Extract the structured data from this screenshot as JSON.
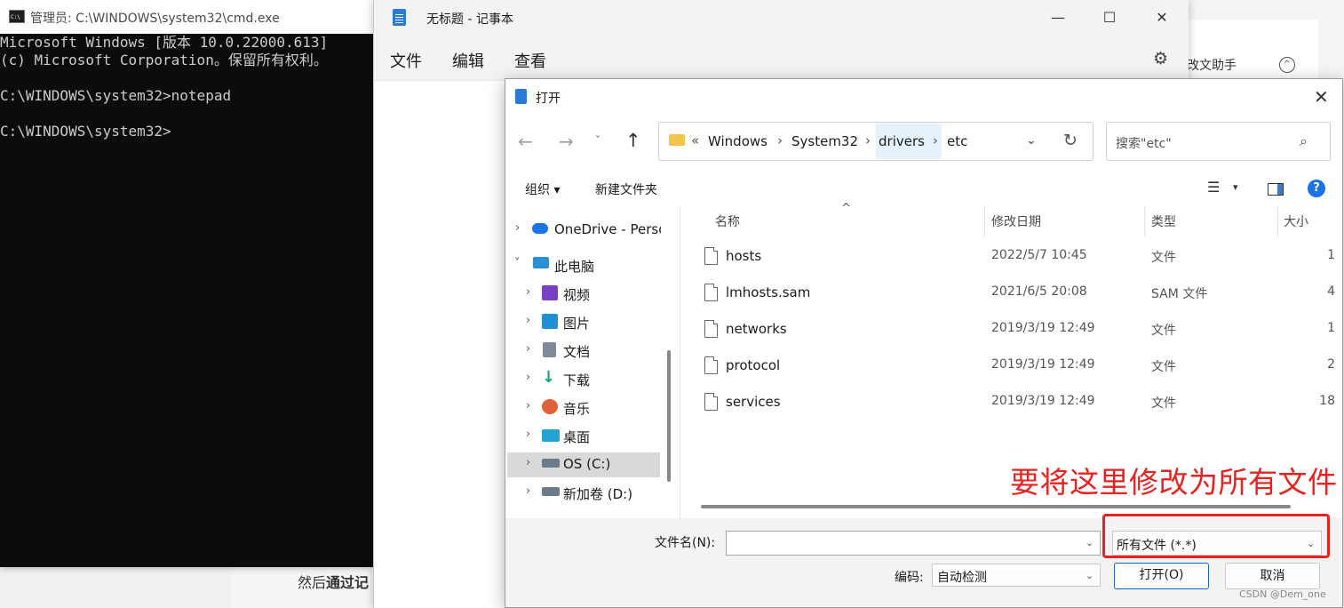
{
  "background": {
    "assistant_text": "改文助手",
    "bottom_text_prefix": "然后",
    "bottom_text_bold": "通过记"
  },
  "cmd": {
    "title": "管理员: C:\\WINDOWS\\system32\\cmd.exe",
    "lines": [
      "Microsoft Windows [版本 10.0.22000.613]",
      "(c) Microsoft Corporation。保留所有权利。",
      "",
      "C:\\WINDOWS\\system32>notepad",
      "",
      "C:\\WINDOWS\\system32>"
    ]
  },
  "notepad": {
    "title": "无标题 - 记事本",
    "menu": [
      "文件",
      "编辑",
      "查看"
    ]
  },
  "dialog": {
    "title": "打开",
    "breadcrumbs": [
      "Windows",
      "System32",
      "drivers",
      "etc"
    ],
    "search_placeholder": "搜索\"etc\"",
    "toolbar": {
      "organize": "组织 ▾",
      "new_folder": "新建文件夹"
    },
    "nav_tree": [
      {
        "label": "OneDrive - Perso",
        "icon": "onedrive-icon",
        "color": "#1a73e8"
      },
      {
        "label": "此电脑",
        "icon": "pc-icon",
        "color": "#2b8fd6"
      },
      {
        "label": "视频",
        "icon": "video-icon",
        "color": "#7b3fc4"
      },
      {
        "label": "图片",
        "icon": "picture-icon",
        "color": "#1f8fd6"
      },
      {
        "label": "文档",
        "icon": "document-icon",
        "color": "#7d8a99"
      },
      {
        "label": "下载",
        "icon": "download-icon",
        "color": "#1aa37a"
      },
      {
        "label": "音乐",
        "icon": "music-icon",
        "color": "#e0603a"
      },
      {
        "label": "桌面",
        "icon": "desktop-icon",
        "color": "#23a3d6"
      },
      {
        "label": "OS (C:)",
        "icon": "drive-c-icon",
        "color": "#6b7b8c"
      },
      {
        "label": "新加卷 (D:)",
        "icon": "drive-d-icon",
        "color": "#6b7b8c"
      }
    ],
    "columns": {
      "name": "名称",
      "modified": "修改日期",
      "type": "类型",
      "size": "大小"
    },
    "files": [
      {
        "name": "hosts",
        "modified": "2022/5/7 10:45",
        "type": "文件",
        "size": "1"
      },
      {
        "name": "lmhosts.sam",
        "modified": "2021/6/5 20:08",
        "type": "SAM 文件",
        "size": "4"
      },
      {
        "name": "networks",
        "modified": "2019/3/19 12:49",
        "type": "文件",
        "size": "1"
      },
      {
        "name": "protocol",
        "modified": "2019/3/19 12:49",
        "type": "文件",
        "size": "2"
      },
      {
        "name": "services",
        "modified": "2019/3/19 12:49",
        "type": "文件",
        "size": "18"
      }
    ],
    "filename_label": "文件名(N):",
    "filename_value": "",
    "filetype_value": "所有文件  (*.*)",
    "encoding_label": "编码:",
    "encoding_value": "自动检测",
    "open_button": "打开(O)",
    "cancel_button": "取消"
  },
  "annotation": "要将这里修改为所有文件",
  "watermark": "CSDN @Dem_one"
}
